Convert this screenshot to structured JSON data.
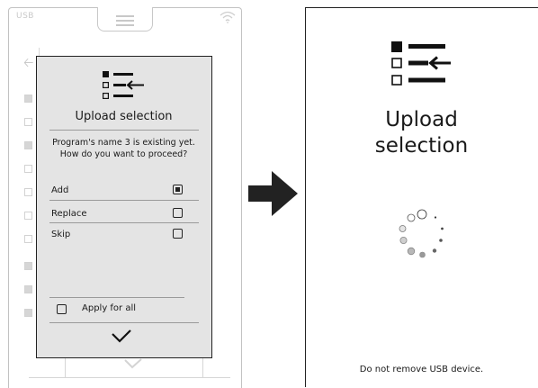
{
  "background_screen": {
    "status_label": "USB"
  },
  "dialog": {
    "title": "Upload selection",
    "message_line1": "Program's name 3 is existing yet.",
    "message_line2": "How do you want to proceed?",
    "options": [
      {
        "label": "Add",
        "checked": true
      },
      {
        "label": "Replace",
        "checked": false
      },
      {
        "label": "Skip",
        "checked": false
      }
    ],
    "apply_all_label": "Apply for all",
    "apply_all_checked": false,
    "confirm_icon": "checkmark-icon"
  },
  "transition_icon": "right-arrow-icon",
  "progress_screen": {
    "title_line1": "Upload",
    "title_line2": "selection",
    "spinner_icon": "loading-spinner-icon",
    "footer": "Do not remove USB device."
  }
}
